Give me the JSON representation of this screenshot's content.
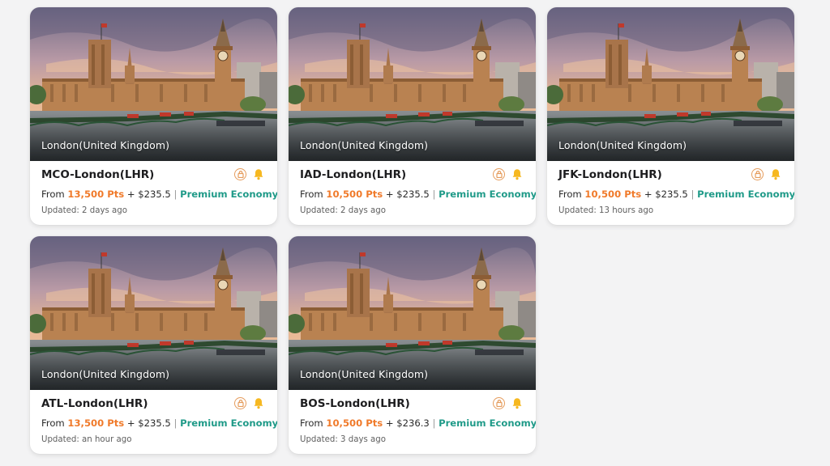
{
  "cards": [
    {
      "location": "London(United Kingdom)",
      "route": "MCO-London(LHR)",
      "from_label": "From",
      "points": "13,500 Pts",
      "plus": "+",
      "cash": "$235.5",
      "separator": "|",
      "cabin": "Premium Economy",
      "updated": "Updated: 2 days ago"
    },
    {
      "location": "London(United Kingdom)",
      "route": "IAD-London(LHR)",
      "from_label": "From",
      "points": "10,500 Pts",
      "plus": "+",
      "cash": "$235.5",
      "separator": "|",
      "cabin": "Premium Economy",
      "updated": "Updated: 2 days ago"
    },
    {
      "location": "London(United Kingdom)",
      "route": "JFK-London(LHR)",
      "from_label": "From",
      "points": "10,500 Pts",
      "plus": "+",
      "cash": "$235.5",
      "separator": "|",
      "cabin": "Premium Economy",
      "updated": "Updated: 13 hours ago"
    },
    {
      "location": "London(United Kingdom)",
      "route": "ATL-London(LHR)",
      "from_label": "From",
      "points": "13,500 Pts",
      "plus": "+",
      "cash": "$235.5",
      "separator": "|",
      "cabin": "Premium Economy",
      "updated": "Updated: an hour ago"
    },
    {
      "location": "London(United Kingdom)",
      "route": "BOS-London(LHR)",
      "from_label": "From",
      "points": "10,500 Pts",
      "plus": "+",
      "cash": "$236.3",
      "separator": "|",
      "cabin": "Premium Economy",
      "updated": "Updated: 3 days ago"
    }
  ],
  "icons": {
    "lock": "lock-icon",
    "bell": "bell-icon"
  },
  "colors": {
    "points": "#f07a2a",
    "cabin": "#1f9a88",
    "bell": "#f6b820",
    "lock": "#e59c5c"
  }
}
